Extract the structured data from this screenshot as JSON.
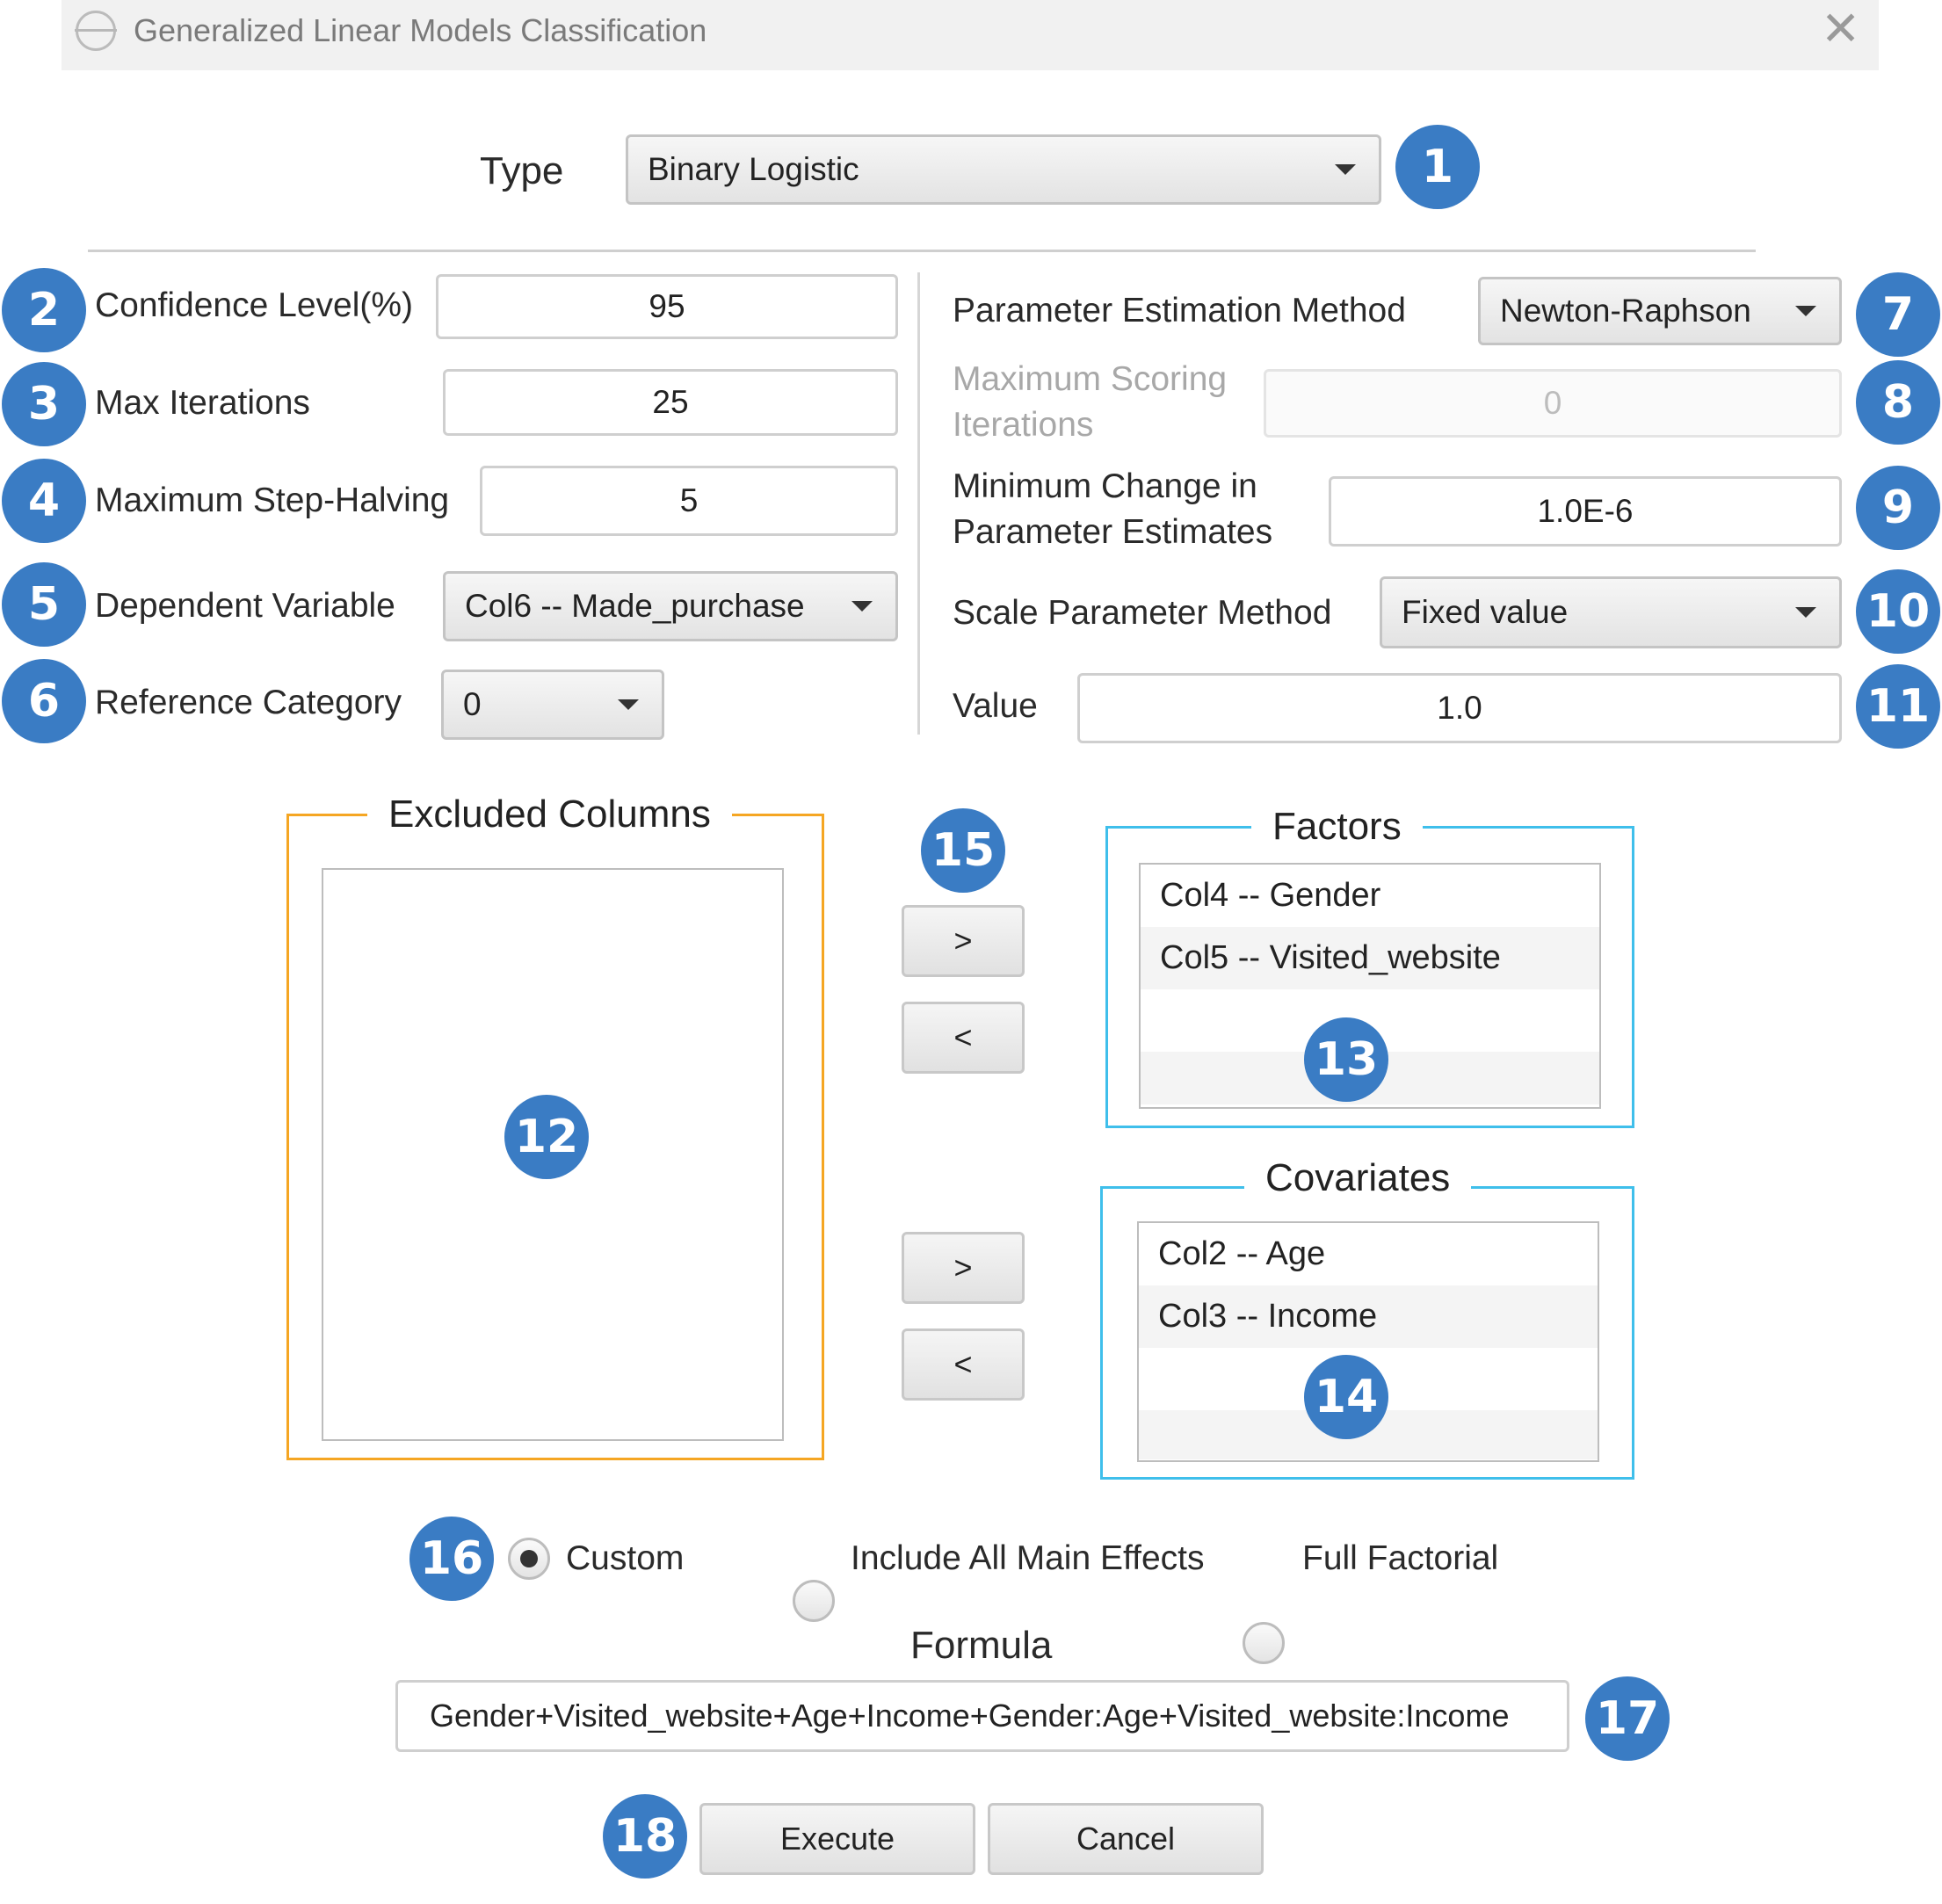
{
  "window": {
    "title": "Generalized Linear Models Classification",
    "close_glyph": "✕",
    "icon": "app-icon"
  },
  "type": {
    "label": "Type",
    "value": "Binary Logistic"
  },
  "left_params": {
    "confidence_label": "Confidence Level(%)",
    "confidence_value": "95",
    "max_iter_label": "Max Iterations",
    "max_iter_value": "25",
    "step_halving_label": "Maximum Step-Halving",
    "step_halving_value": "5",
    "dependent_label": "Dependent Variable",
    "dependent_value": "Col6 -- Made_purchase",
    "reference_label": "Reference Category",
    "reference_value": "0"
  },
  "right_params": {
    "estimation_label": "Parameter Estimation Method",
    "estimation_value": "Newton-Raphson",
    "scoring_label_1": "Maximum Scoring",
    "scoring_label_2": "Iterations",
    "scoring_value": "0",
    "min_change_label_1": "Minimum Change in",
    "min_change_label_2": "Parameter Estimates",
    "min_change_value": "1.0E-6",
    "scale_label": "Scale Parameter Method",
    "scale_value": "Fixed value",
    "value_label": "Value",
    "value_value": "1.0"
  },
  "excluded": {
    "title": "Excluded Columns",
    "items": []
  },
  "factors": {
    "title": "Factors",
    "items": [
      "Col4 -- Gender",
      "Col5 -- Visited_website"
    ]
  },
  "covariates": {
    "title": "Covariates",
    "items": [
      "Col2 -- Age",
      "Col3 -- Income"
    ]
  },
  "move_buttons": {
    "add": ">",
    "remove": "<"
  },
  "model_options": {
    "custom": "Custom",
    "main_effects": "Include All Main Effects",
    "full_factorial": "Full Factorial",
    "selected": "custom"
  },
  "formula": {
    "label": "Formula",
    "value": "Gender+Visited_website+Age+Income+Gender:Age+Visited_website:Income"
  },
  "actions": {
    "execute": "Execute",
    "cancel": "Cancel"
  },
  "badges": [
    "1",
    "2",
    "3",
    "4",
    "5",
    "6",
    "7",
    "8",
    "9",
    "10",
    "11",
    "12",
    "13",
    "14",
    "15",
    "16",
    "17",
    "18"
  ],
  "colors": {
    "badge": "#3a7cc4",
    "excluded_border": "#f5a623",
    "list_border": "#3fbfeb"
  }
}
